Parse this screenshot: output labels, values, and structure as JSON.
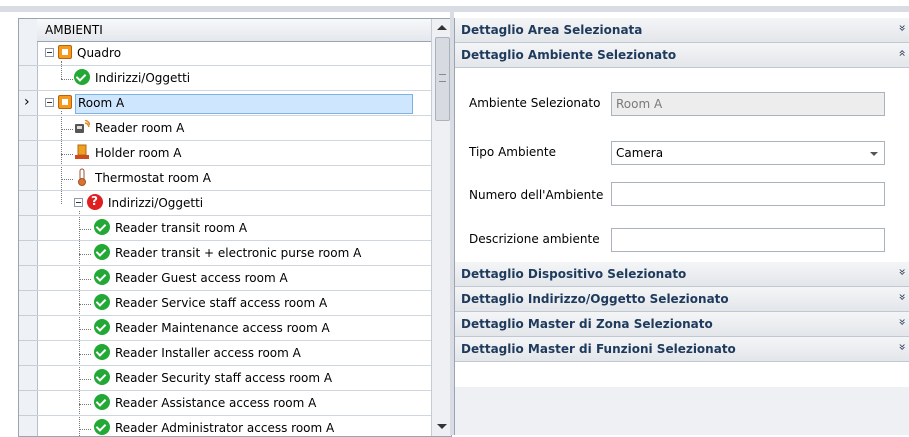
{
  "tree": {
    "header": "AMBIENTI",
    "rows": [
      {
        "label": "Quadro",
        "icon": "panel-icon"
      },
      {
        "label": "Indirizzi/Oggetti",
        "icon": "check-icon"
      },
      {
        "label": "Room A",
        "icon": "panel-icon"
      },
      {
        "label": "Reader room A",
        "icon": "reader-icon"
      },
      {
        "label": "Holder room A",
        "icon": "holder-icon"
      },
      {
        "label": "Thermostat room A",
        "icon": "thermostat-icon"
      },
      {
        "label": "Indirizzi/Oggetti",
        "icon": "warning-icon"
      },
      {
        "label": "Reader transit room A",
        "icon": "check-icon"
      },
      {
        "label": "Reader transit + electronic purse room A",
        "icon": "check-icon"
      },
      {
        "label": "Reader Guest access room A",
        "icon": "check-icon"
      },
      {
        "label": "Reader Service staff access room A",
        "icon": "check-icon"
      },
      {
        "label": "Reader Maintenance access room A",
        "icon": "check-icon"
      },
      {
        "label": "Reader Installer access room A",
        "icon": "check-icon"
      },
      {
        "label": "Reader Security staff access room A",
        "icon": "check-icon"
      },
      {
        "label": "Reader Assistance access room A",
        "icon": "check-icon"
      },
      {
        "label": "Reader Administrator access room A",
        "icon": "check-icon"
      }
    ],
    "current_row_marker": "›"
  },
  "right": {
    "groups": {
      "area": "Dettaglio Area Selezionata",
      "ambiente": "Dettaglio Ambiente Selezionato",
      "dispositivo": "Dettaglio Dispositivo Selezionato",
      "indirizzo": "Dettaglio Indirizzo/Oggetto Selezionato",
      "zona": "Dettaglio Master di Zona Selezionato",
      "funzioni": "Dettaglio Master di Funzioni Selezionato"
    },
    "chevrons": {
      "collapsed": "»",
      "expanded": "«"
    },
    "form": {
      "ambiente_label": "Ambiente Selezionato",
      "ambiente_value": "Room A",
      "tipo_label": "Tipo Ambiente",
      "tipo_value": "Camera",
      "numero_label": "Numero dell'Ambiente",
      "numero_value": "",
      "descrizione_label": "Descrizione ambiente",
      "descrizione_value": ""
    }
  }
}
